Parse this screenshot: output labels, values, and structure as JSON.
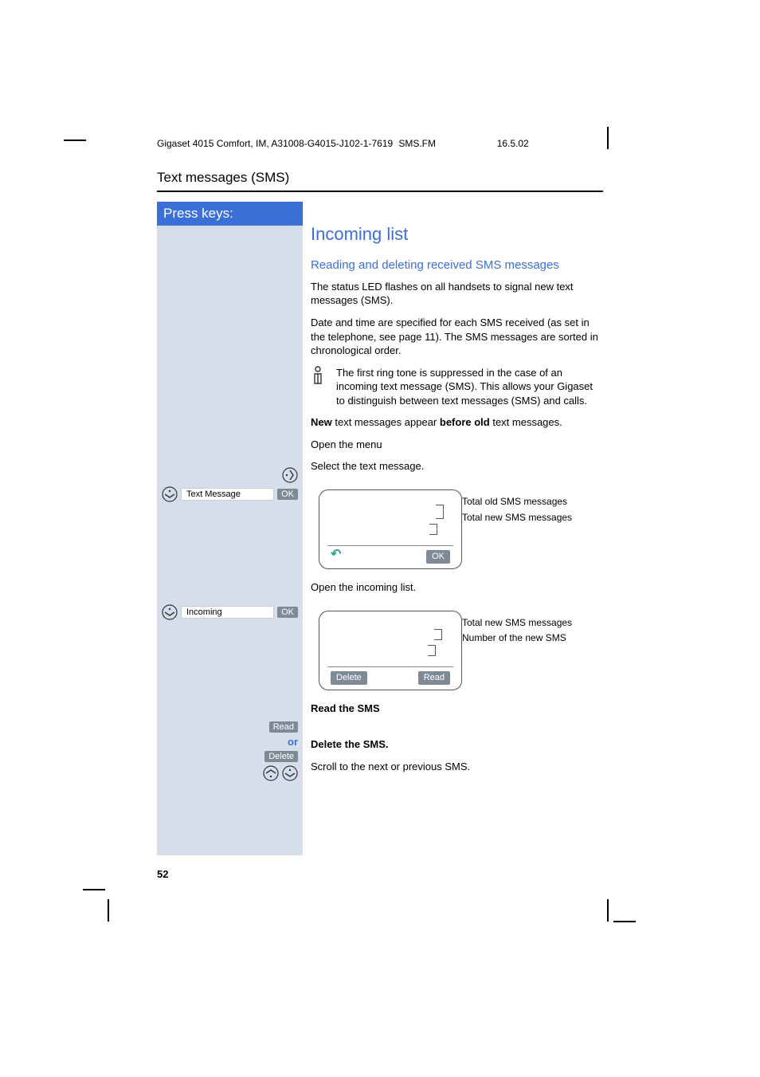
{
  "header": {
    "left": "Gigaset 4015 Comfort, IM, A31008-G4015-J102-1-7619",
    "mid": "SMS.FM",
    "right": "16.5.02"
  },
  "section_title": "Text messages (SMS)",
  "keys": {
    "header": "Press keys:",
    "text_message_label": "Text Message",
    "ok": "OK",
    "incoming_label": "Incoming",
    "read_btn": "Read",
    "or": "or",
    "delete_btn": "Delete"
  },
  "content": {
    "h1": "Incoming list",
    "h2": "Reading and deleting received SMS messages",
    "p1": "The status LED flashes on all handsets to signal new text messages (SMS).",
    "p2": "Date and time are specified for each SMS received (as set in the telephone, see page 11). The SMS messages are sorted in chronological order.",
    "note": "The first ring tone is suppressed in the case of an incoming text message (SMS). This allows your Gigaset to distinguish between text messages (SMS) and calls.",
    "p3_a": "New",
    "p3_b": " text messages appear ",
    "p3_c": "before old",
    "p3_d": " text messages.",
    "step_open_menu": "Open the menu",
    "step_select_text": "Select the text message.",
    "step_open_incoming": "Open the incoming list.",
    "callout1a": "Total old SMS messages",
    "callout1b": "Total new SMS messages",
    "callout2a": "Total new SMS messages",
    "callout2b": "Number of the new SMS",
    "screen1_ok": "OK",
    "screen2_delete": "Delete",
    "screen2_read": "Read",
    "read_sms": "Read the SMS",
    "delete_sms": "Delete the SMS.",
    "scroll": "Scroll to the next or previous SMS."
  },
  "page_number": "52"
}
